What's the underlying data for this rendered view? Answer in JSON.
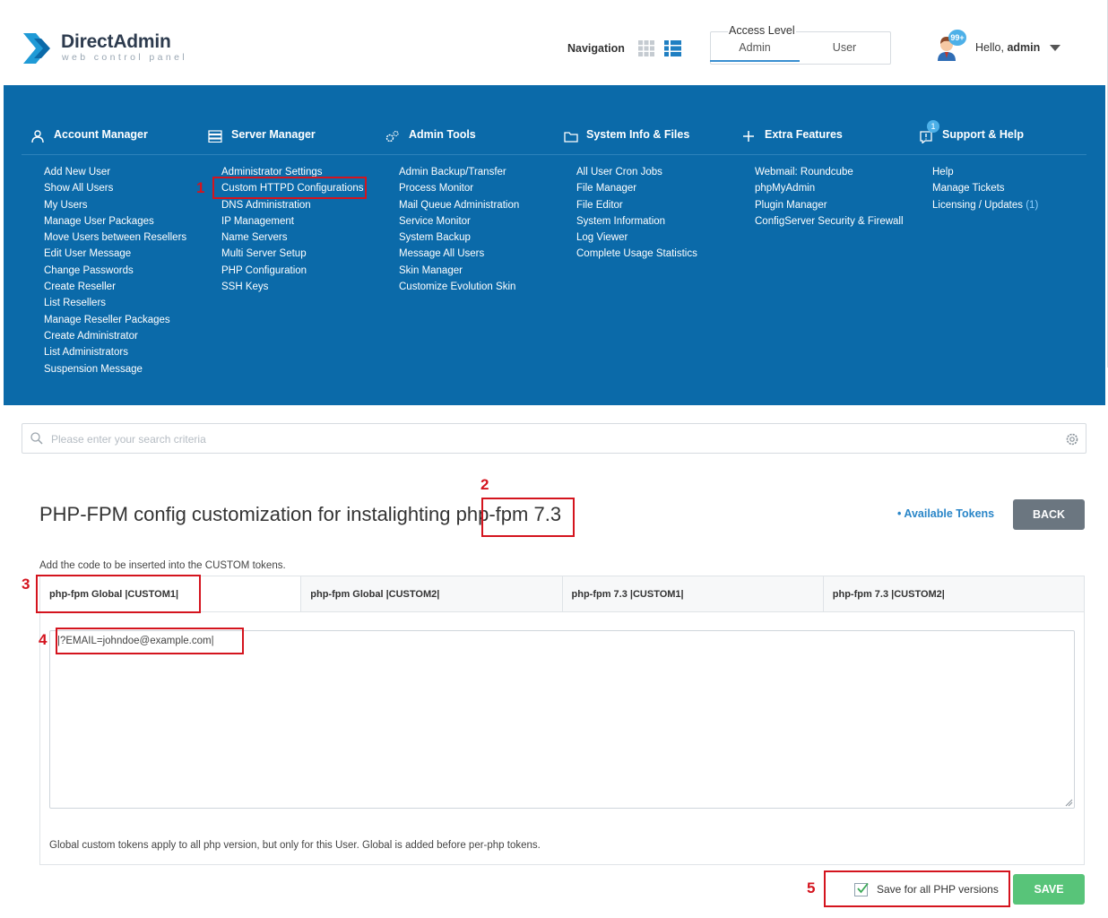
{
  "header": {
    "logo_title": "DirectAdmin",
    "logo_subtitle": "web control panel",
    "navigation_label": "Navigation",
    "access_level_title": "Access Level",
    "access_levels": [
      "Admin",
      "User"
    ],
    "active_access_level": "Admin",
    "notification_badge": "99+",
    "hello_prefix": "Hello,",
    "username": "admin"
  },
  "menu": {
    "columns": [
      {
        "title": "Account Manager",
        "icon": "user-icon",
        "items": [
          "Add New User",
          "Show All Users",
          "My Users",
          "Manage User Packages",
          "Move Users between Resellers",
          "Edit User Message",
          "Change Passwords",
          "Create Reseller",
          "List Resellers",
          "Manage Reseller Packages",
          "Create Administrator",
          "List Administrators",
          "Suspension Message"
        ]
      },
      {
        "title": "Server Manager",
        "icon": "server-icon",
        "items": [
          "Administrator Settings",
          "Custom HTTPD Configurations",
          "DNS Administration",
          "IP Management",
          "Name Servers",
          "Multi Server Setup",
          "PHP Configuration",
          "SSH Keys"
        ]
      },
      {
        "title": "Admin Tools",
        "icon": "gears-icon",
        "items": [
          "Admin Backup/Transfer",
          "Process Monitor",
          "Mail Queue Administration",
          "Service Monitor",
          "System Backup",
          "Message All Users",
          "Skin Manager",
          "Customize Evolution Skin"
        ]
      },
      {
        "title": "System Info & Files",
        "icon": "folder-icon",
        "items": [
          "All User Cron Jobs",
          "File Manager",
          "File Editor",
          "System Information",
          "Log Viewer",
          "Complete Usage Statistics"
        ]
      },
      {
        "title": "Extra Features",
        "icon": "plus-icon",
        "items": [
          "Webmail: Roundcube",
          "phpMyAdmin",
          "Plugin Manager",
          "ConfigServer Security & Firewall"
        ]
      },
      {
        "title": "Support & Help",
        "icon": "support-icon",
        "badge": "1",
        "items": [
          "Help",
          "Manage Tickets",
          "Licensing / Updates"
        ],
        "licensing_count": "(1)"
      }
    ]
  },
  "search": {
    "placeholder": "Please enter your search criteria"
  },
  "page": {
    "title_before": "PHP-FPM config customization for instalighting ",
    "title_highlight": "php-fpm",
    "title_after": " 7.3",
    "available_tokens": "• Available Tokens",
    "back_label": "BACK",
    "hint": "Add the code to be inserted into the CUSTOM tokens.",
    "tabs": [
      "php-fpm Global |CUSTOM1|",
      "php-fpm Global |CUSTOM2|",
      "php-fpm 7.3 |CUSTOM1|",
      "php-fpm 7.3 |CUSTOM2|"
    ],
    "active_tab": 0,
    "code_value": "|?EMAIL=johndoe@example.com|",
    "panel_note": "Global custom tokens apply to all php version, but only for this User. Global is added before per-php tokens.",
    "save_all_label": "Save for all PHP versions",
    "save_all_checked": true,
    "save_label": "SAVE"
  },
  "annotations": [
    "1",
    "2",
    "3",
    "4",
    "5"
  ],
  "colors": {
    "menu_bg": "#0b6aa9",
    "annotation": "#d4141e",
    "save": "#58c479",
    "back": "#6b7680",
    "link": "#2a86c8"
  }
}
